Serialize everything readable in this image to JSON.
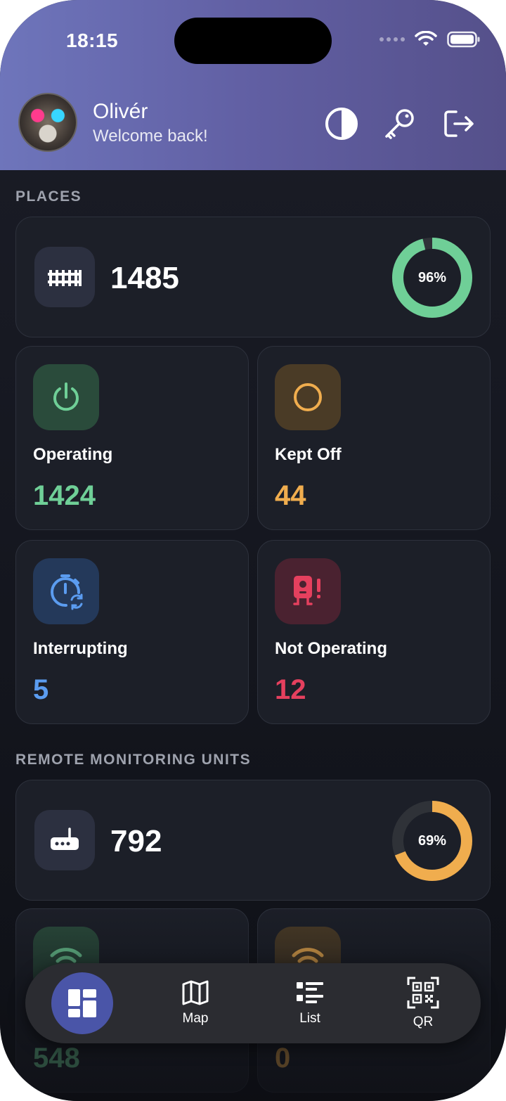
{
  "status_bar": {
    "time": "18:15"
  },
  "user": {
    "name": "Olivér",
    "welcome": "Welcome back!"
  },
  "header_actions": [
    "theme-toggle",
    "key",
    "logout"
  ],
  "places": {
    "section_title": "PLACES",
    "total": "1485",
    "percent_label": "96%",
    "percent_value": 0.96,
    "ring_color": "#6fcf97",
    "stats": [
      {
        "label": "Operating",
        "value": "1424",
        "color": "#6fcf97",
        "icon": "power-icon"
      },
      {
        "label": "Kept Off",
        "value": "44",
        "color": "#f0ad4e",
        "icon": "circle-icon"
      },
      {
        "label": "Interrupting",
        "value": "5",
        "color": "#5b9cf0",
        "icon": "timer-sync-icon"
      },
      {
        "label": "Not Operating",
        "value": "12",
        "color": "#e5405e",
        "icon": "device-alert-icon"
      }
    ]
  },
  "rmu": {
    "section_title": "REMOTE MONITORING UNITS",
    "total": "792",
    "percent_label": "69%",
    "percent_value": 0.69,
    "ring_color": "#f0ad4e",
    "stats": [
      {
        "value": "548",
        "color": "#6fcf97",
        "icon": "wifi-icon"
      },
      {
        "value": "0",
        "color": "#f0ad4e",
        "icon": "wifi-icon"
      }
    ]
  },
  "nav": {
    "items": [
      {
        "label": "",
        "icon": "dashboard-icon",
        "active": true
      },
      {
        "label": "Map",
        "icon": "map-icon"
      },
      {
        "label": "List",
        "icon": "list-icon"
      },
      {
        "label": "QR",
        "icon": "qr-icon"
      }
    ]
  }
}
